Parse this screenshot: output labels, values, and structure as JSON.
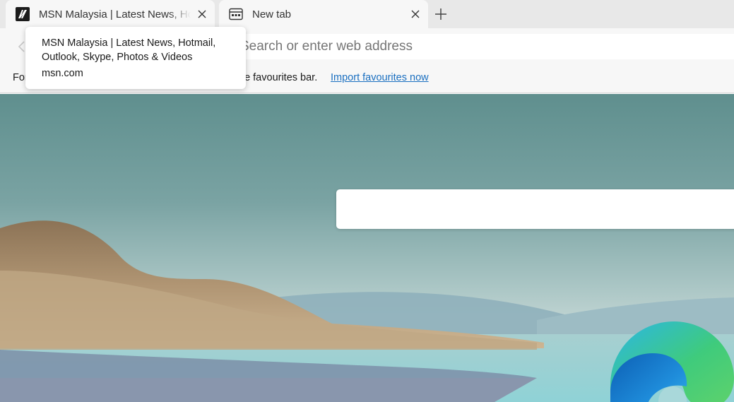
{
  "tabs": [
    {
      "title": "MSN Malaysia | Latest News, Hotmail, Outlook, Skype, Photos & Videos",
      "favicon": "msn-icon",
      "close_icon": "close-icon"
    },
    {
      "title": "New tab",
      "favicon": "new-tab-page-icon",
      "close_icon": "close-icon"
    }
  ],
  "new_tab_icon": "plus-icon",
  "back_icon": "back-arrow-icon",
  "address_bar": {
    "value": "",
    "placeholder": "Search or enter web address"
  },
  "favourites_bar": {
    "prompt_visible_start": "For",
    "prompt_visible_end": "he favourites bar.",
    "import_link": "Import favourites now"
  },
  "tooltip": {
    "title": "MSN Malaysia | Latest News, Hotmail, Outlook, Skype, Photos & Videos",
    "url": "msn.com"
  },
  "colors": {
    "tab_strip": "#e8e8e8",
    "toolbar": "#f7f7f7",
    "link": "#1a6fc0"
  }
}
